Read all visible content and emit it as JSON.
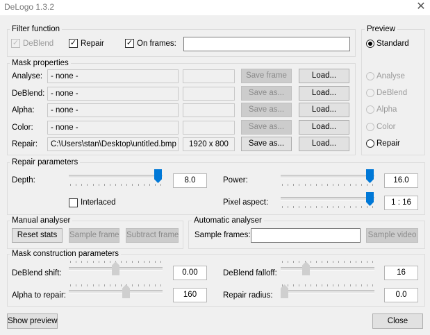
{
  "window": {
    "title": "DeLogo 1.3.2",
    "close_glyph": "✕"
  },
  "filter_function": {
    "group_label": "Filter function",
    "deblend": {
      "label": "DeBlend",
      "checked": true,
      "enabled": false
    },
    "repair": {
      "label": "Repair",
      "checked": true
    },
    "on_frames": {
      "label": "On frames:",
      "checked": true,
      "value": ""
    }
  },
  "mask_properties": {
    "group_label": "Mask properties",
    "rows": [
      {
        "label": "Analyse:",
        "path": "- none -",
        "size": "",
        "action": "Save frame",
        "action_enabled": false,
        "load": "Load..."
      },
      {
        "label": "DeBlend:",
        "path": "- none -",
        "size": "",
        "action": "Save as...",
        "action_enabled": false,
        "load": "Load..."
      },
      {
        "label": "Alpha:",
        "path": "- none -",
        "size": "",
        "action": "Save as...",
        "action_enabled": false,
        "load": "Load..."
      },
      {
        "label": "Color:",
        "path": "- none -",
        "size": "",
        "action": "Save as...",
        "action_enabled": false,
        "load": "Load..."
      },
      {
        "label": "Repair:",
        "path": "C:\\Users\\stan\\Desktop\\untitled.bmp",
        "size": "1920 x 800",
        "action": "Save as...",
        "action_enabled": true,
        "load": "Load..."
      }
    ]
  },
  "preview": {
    "group_label": "Preview",
    "options": [
      {
        "label": "Standard",
        "selected": true,
        "enabled": true
      },
      {
        "label": "Analyse",
        "selected": false,
        "enabled": false
      },
      {
        "label": "DeBlend",
        "selected": false,
        "enabled": false
      },
      {
        "label": "Alpha",
        "selected": false,
        "enabled": false
      },
      {
        "label": "Color",
        "selected": false,
        "enabled": false
      },
      {
        "label": "Repair",
        "selected": false,
        "enabled": true
      }
    ]
  },
  "repair_parameters": {
    "group_label": "Repair parameters",
    "depth": {
      "label": "Depth:",
      "value": "8.0",
      "slider_fraction": 1.0
    },
    "power": {
      "label": "Power:",
      "value": "16.0",
      "slider_fraction": 1.0
    },
    "interlaced": {
      "label": "Interlaced",
      "checked": false
    },
    "pixel_aspect": {
      "label": "Pixel aspect:",
      "value": "1 : 16",
      "slider_fraction": 1.0
    }
  },
  "manual_analyser": {
    "group_label": "Manual analyser",
    "reset_stats": "Reset stats",
    "sample_frame": "Sample frame",
    "subtract_frame": "Subtract frame"
  },
  "automatic_analyser": {
    "group_label": "Automatic analyser",
    "sample_frames_label": "Sample frames:",
    "sample_frames_value": "",
    "sample_video": "Sample video"
  },
  "mask_construction": {
    "group_label": "Mask construction parameters",
    "deblend_shift": {
      "label": "DeBlend shift:",
      "value": "0.00",
      "slider_fraction": 0.5
    },
    "deblend_falloff": {
      "label": "DeBlend falloff:",
      "value": "16",
      "slider_fraction": 0.25
    },
    "alpha_to_repair": {
      "label": "Alpha to repair:",
      "value": "160",
      "slider_fraction": 0.625
    },
    "repair_radius": {
      "label": "Repair radius:",
      "value": "0.0",
      "slider_fraction": 0.0
    }
  },
  "footer": {
    "show_preview": "Show preview",
    "close": "Close"
  },
  "colors": {
    "accent": "#0078d7",
    "background": "#f0f0f0"
  }
}
